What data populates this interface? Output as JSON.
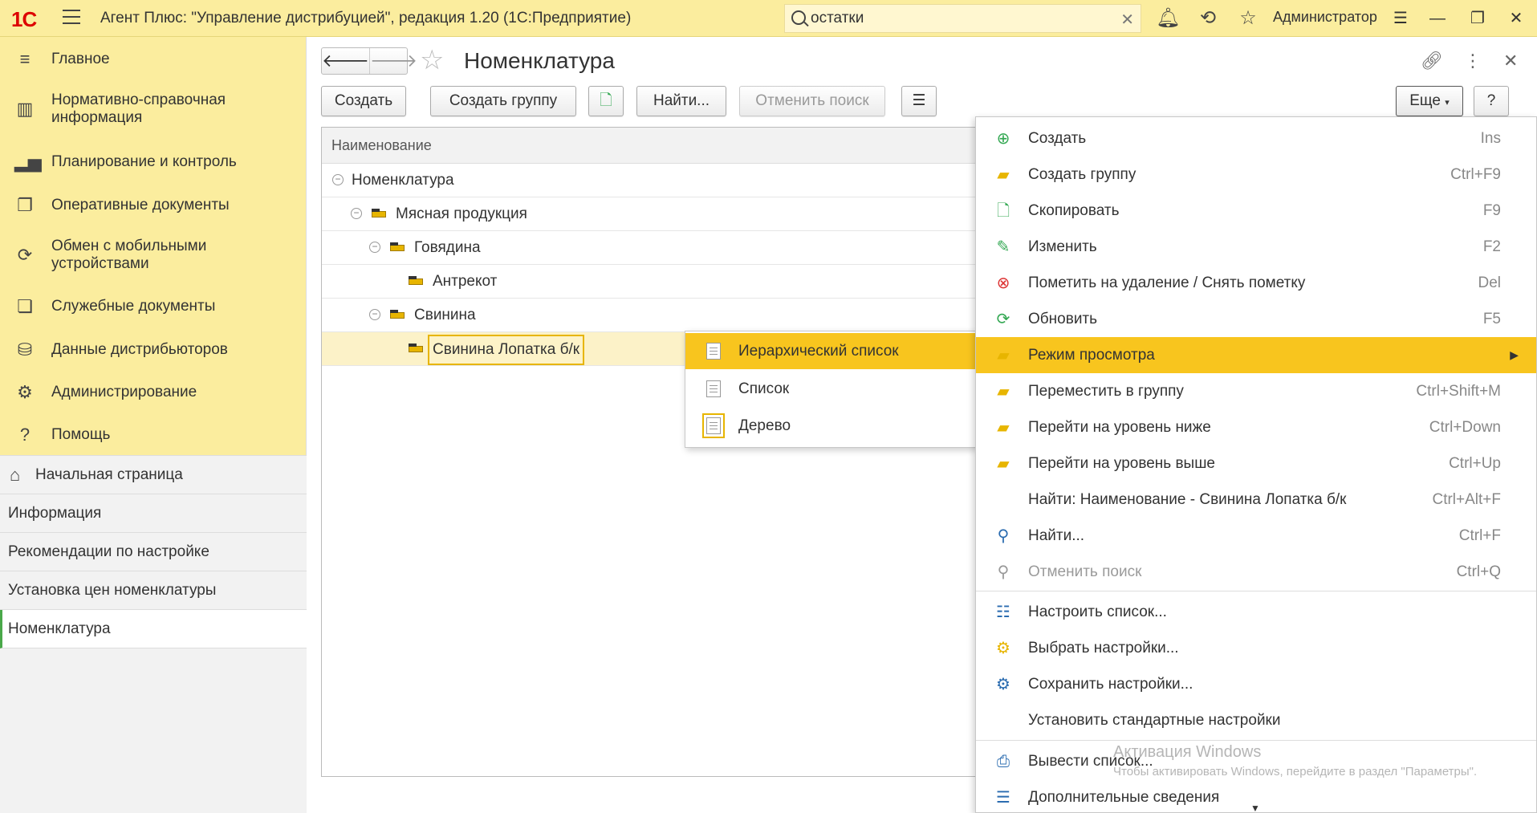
{
  "titlebar": {
    "logo": "1С",
    "title": "Агент Плюс: \"Управление дистрибуцией\", редакция 1.20  (1С:Предприятие)",
    "search_value": "остатки",
    "user": "Администратор"
  },
  "sidebar": {
    "sections": [
      {
        "label": "Главное",
        "icon": "hamburger-icon"
      },
      {
        "label": "Нормативно-справочная информация",
        "icon": "bar-chart-icon"
      },
      {
        "label": "Планирование и контроль",
        "icon": "chart-icon"
      },
      {
        "label": "Оперативные документы",
        "icon": "documents-icon"
      },
      {
        "label": "Обмен с мобильными устройствами",
        "icon": "sync-icon"
      },
      {
        "label": "Служебные документы",
        "icon": "service-docs-icon"
      },
      {
        "label": "Данные дистрибьюторов",
        "icon": "database-icon"
      },
      {
        "label": "Администрирование",
        "icon": "gear-icon"
      },
      {
        "label": "Помощь",
        "icon": "question-icon"
      }
    ],
    "open_windows": [
      {
        "label": "Начальная страница"
      },
      {
        "label": "Информация"
      },
      {
        "label": "Рекомендации по настройке"
      },
      {
        "label": "Установка цен номенклатуры"
      },
      {
        "label": "Номенклатура"
      }
    ]
  },
  "main": {
    "title": "Номенклатура",
    "buttons": {
      "create": "Создать",
      "create_group": "Создать группу",
      "find": "Найти...",
      "cancel_search": "Отменить поиск",
      "more": "Еще",
      "help": "?"
    },
    "table": {
      "header": "Наименование",
      "rows": [
        {
          "label": "Номенклатура"
        },
        {
          "label": "Мясная продукция"
        },
        {
          "label": "Говядина"
        },
        {
          "label": "Антрекот"
        },
        {
          "label": "Свинина"
        },
        {
          "label": "Свинина Лопатка б/к"
        }
      ]
    }
  },
  "submenu": {
    "items": [
      {
        "label": "Иерархический список"
      },
      {
        "label": "Список"
      },
      {
        "label": "Дерево"
      }
    ]
  },
  "dropdown": {
    "items": [
      {
        "label": "Создать",
        "shortcut": "Ins"
      },
      {
        "label": "Создать группу",
        "shortcut": "Ctrl+F9"
      },
      {
        "label": "Скопировать",
        "shortcut": "F9"
      },
      {
        "label": "Изменить",
        "shortcut": "F2"
      },
      {
        "label": "Пометить на удаление / Снять пометку",
        "shortcut": "Del"
      },
      {
        "label": "Обновить",
        "shortcut": "F5"
      },
      {
        "label": "Режим просмотра",
        "shortcut": ""
      },
      {
        "label": "Переместить в группу",
        "shortcut": "Ctrl+Shift+M"
      },
      {
        "label": "Перейти на уровень ниже",
        "shortcut": "Ctrl+Down"
      },
      {
        "label": "Перейти на уровень выше",
        "shortcut": "Ctrl+Up"
      },
      {
        "label": "Найти: Наименование - Свинина Лопатка б/к",
        "shortcut": "Ctrl+Alt+F"
      },
      {
        "label": "Найти...",
        "shortcut": "Ctrl+F"
      },
      {
        "label": "Отменить поиск",
        "shortcut": "Ctrl+Q"
      },
      {
        "label": "Настроить список...",
        "shortcut": ""
      },
      {
        "label": "Выбрать настройки...",
        "shortcut": ""
      },
      {
        "label": "Сохранить настройки...",
        "shortcut": ""
      },
      {
        "label": "Установить стандартные настройки",
        "shortcut": ""
      },
      {
        "label": "Вывести список...",
        "shortcut": ""
      },
      {
        "label": "Дополнительные сведения",
        "shortcut": ""
      }
    ]
  },
  "watermark": {
    "line1": "Активация Windows",
    "line2": "Чтобы активировать Windows, перейдите в раздел \"Параметры\"."
  },
  "colors": {
    "panel": "#fbed9e",
    "highlight": "#f8c51e",
    "selected_row": "#fcf2c8"
  }
}
